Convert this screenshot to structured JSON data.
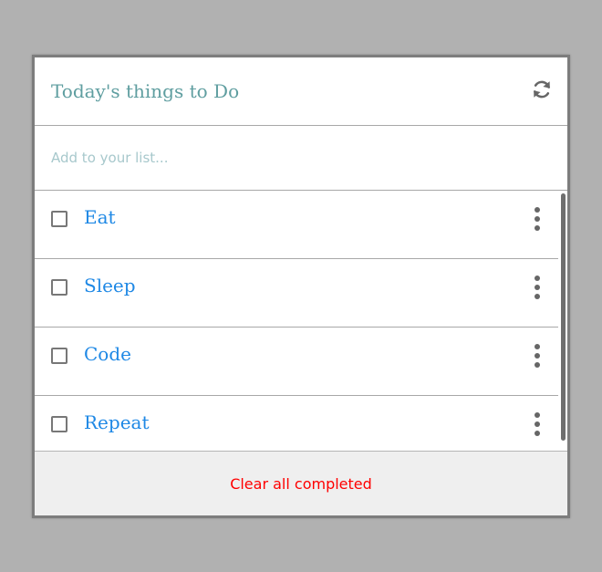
{
  "header": {
    "title": "Today's things to Do",
    "refresh_icon": "refresh-icon"
  },
  "add": {
    "placeholder": "Add to your list...",
    "value": ""
  },
  "items": [
    {
      "label": "Eat",
      "checked": false,
      "menu_icon": "more-vertical-icon"
    },
    {
      "label": "Sleep",
      "checked": false,
      "menu_icon": "more-vertical-icon"
    },
    {
      "label": "Code",
      "checked": false,
      "menu_icon": "more-vertical-icon"
    },
    {
      "label": "Repeat",
      "checked": false,
      "menu_icon": "more-vertical-icon"
    }
  ],
  "footer": {
    "clear_label": "Clear all completed"
  },
  "colors": {
    "title": "#5f9ea0",
    "item_label": "#1e88e5",
    "clear": "#ff0000",
    "background": "#b1b1b1",
    "footer_bg": "#efefef"
  }
}
